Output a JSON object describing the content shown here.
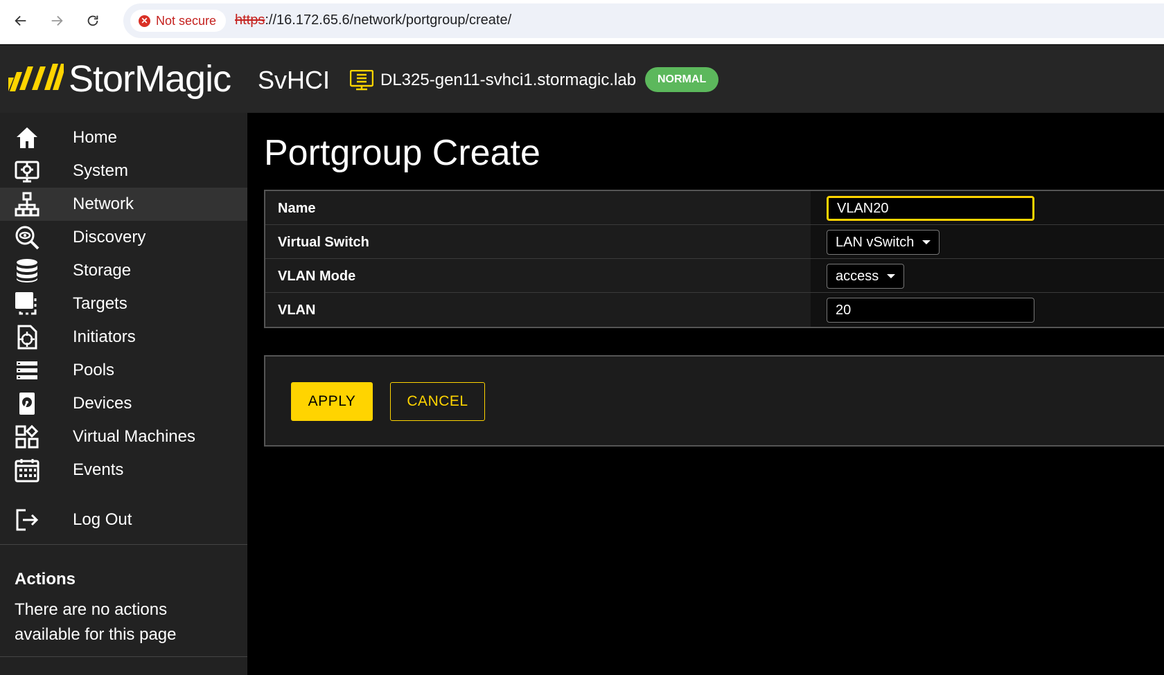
{
  "browser": {
    "security_label": "Not secure",
    "url_scheme": "https",
    "url_rest": "://16.172.65.6/network/portgroup/create/"
  },
  "header": {
    "logo": "StorMagic",
    "product": "SvHCI",
    "host": "DL325-gen11-svhci1.stormagic.lab",
    "status": "NORMAL",
    "status_color": "#5cb85c",
    "accent_color": "#ffd400"
  },
  "sidebar": {
    "items": [
      {
        "label": "Home",
        "icon": "home-icon"
      },
      {
        "label": "System",
        "icon": "system-icon"
      },
      {
        "label": "Network",
        "icon": "network-icon",
        "active": true
      },
      {
        "label": "Discovery",
        "icon": "discovery-icon"
      },
      {
        "label": "Storage",
        "icon": "storage-icon"
      },
      {
        "label": "Targets",
        "icon": "targets-icon"
      },
      {
        "label": "Initiators",
        "icon": "initiators-icon"
      },
      {
        "label": "Pools",
        "icon": "pools-icon"
      },
      {
        "label": "Devices",
        "icon": "devices-icon"
      },
      {
        "label": "Virtual Machines",
        "icon": "virtual-machines-icon"
      },
      {
        "label": "Events",
        "icon": "calendar-icon"
      }
    ],
    "logout": "Log Out",
    "actions_title": "Actions",
    "actions_text": "There are no actions available for this page"
  },
  "main": {
    "title": "Portgroup Create",
    "form": {
      "name_label": "Name",
      "name_value": "VLAN20",
      "vswitch_label": "Virtual Switch",
      "vswitch_value": "LAN vSwitch",
      "vlan_mode_label": "VLAN Mode",
      "vlan_mode_value": "access",
      "vlan_label": "VLAN",
      "vlan_value": "20"
    },
    "apply_label": "APPLY",
    "cancel_label": "CANCEL"
  }
}
